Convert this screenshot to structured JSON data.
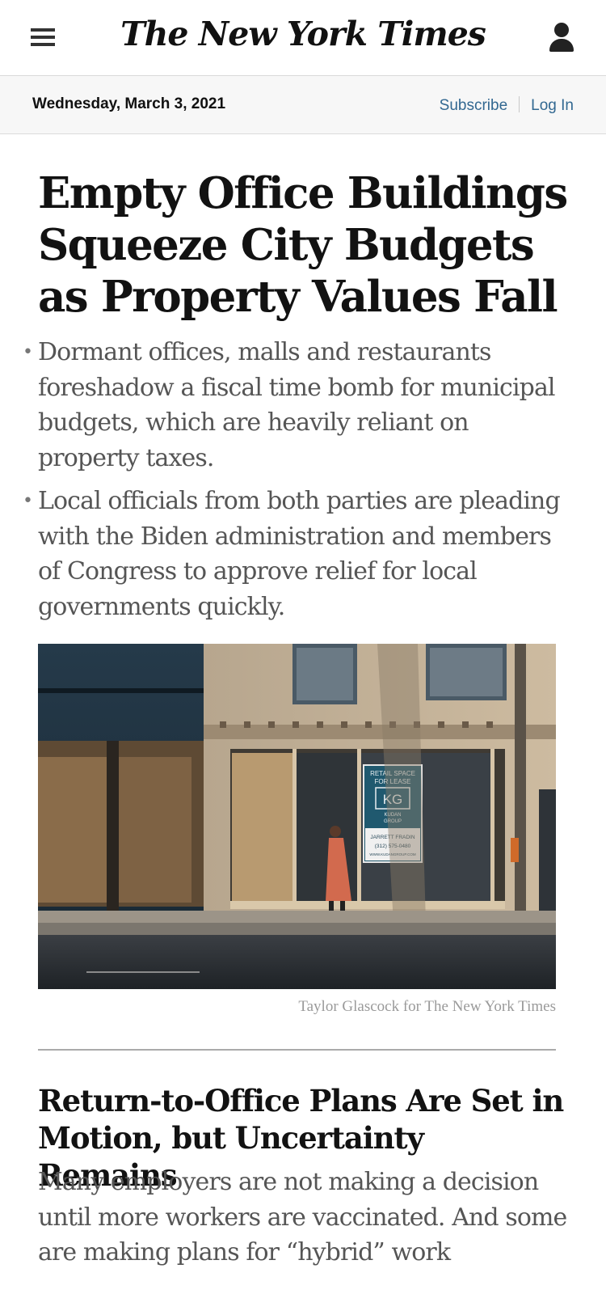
{
  "header": {
    "logo_text": "The New York Times",
    "menu_icon": "hamburger-menu-icon",
    "account_icon": "user-account-icon"
  },
  "datebar": {
    "date": "Wednesday, March 3, 2021",
    "subscribe_label": "Subscribe",
    "login_label": "Log In",
    "link_color": "#326891"
  },
  "lead_story": {
    "headline": "Empty Office Buildings Squeeze City Budgets as Property Values Fall",
    "summary": [
      "Dormant offices, malls and restaurants foreshadow a fiscal time bomb for municipal budgets, which are heavily reliant on property taxes.",
      "Local officials from both parties are pleading with the Biden administration and members of Congress to approve relief for local governments quickly."
    ],
    "photo": {
      "sign_line1": "RETAIL SPACE",
      "sign_line2": "FOR LEASE",
      "sign_logo": "KG",
      "sign_company1": "KUDAN",
      "sign_company2": "GROUP",
      "sign_contact": "JARRETT FRADIN",
      "sign_phone": "(312) 575-0480",
      "sign_web": "WWW.KUDANGROUP.COM"
    },
    "photo_credit": "Taylor Glascock for The New York Times"
  },
  "second_story": {
    "headline": "Return-to-Office Plans Are Set in Motion, but Uncertainty Remains",
    "summary": "Many employers are not making a decision until more workers are vaccinated. And some are making plans for “hybrid” work"
  }
}
